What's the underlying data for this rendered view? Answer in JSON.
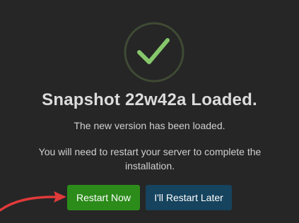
{
  "dialog": {
    "icon": "checkmark-icon",
    "title": "Snapshot 22w42a Loaded.",
    "subtitle": "The new version has been loaded.",
    "message": "You will need to restart your server to complete the installation.",
    "primary_button": "Restart Now",
    "secondary_button": "I'll Restart Later"
  },
  "annotation": {
    "icon": "red-arrow-icon",
    "points_to": "Restart Now"
  },
  "colors": {
    "background": "#262626",
    "check_ring": "#3f4a34",
    "check_mark": "#86c76b",
    "primary_button": "#2c8c1a",
    "secondary_button": "#16435e",
    "annotation_arrow": "#e03a3a"
  }
}
